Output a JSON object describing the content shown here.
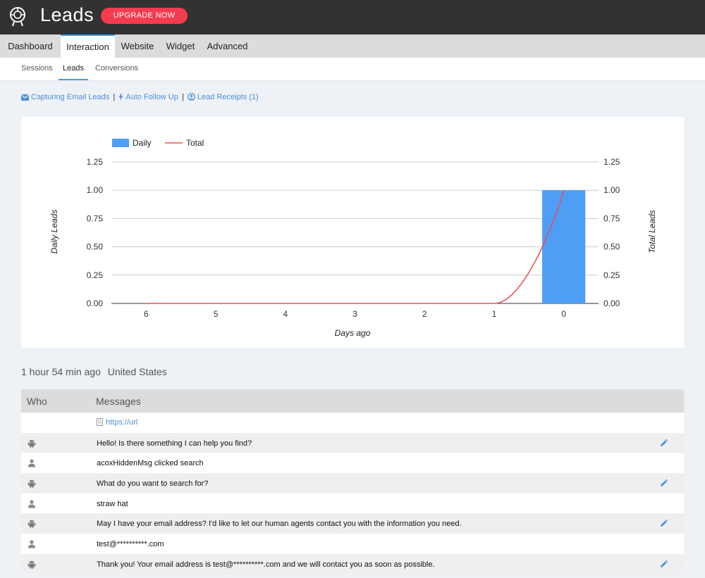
{
  "header": {
    "title": "Leads",
    "upgrade_label": "UPGRADE NOW"
  },
  "main_tabs": [
    {
      "label": "Dashboard"
    },
    {
      "label": "Interaction"
    },
    {
      "label": "Website"
    },
    {
      "label": "Widget"
    },
    {
      "label": "Advanced"
    }
  ],
  "sub_tabs": [
    {
      "label": "Sessions"
    },
    {
      "label": "Leads"
    },
    {
      "label": "Conversions"
    }
  ],
  "links": {
    "capturing": "Capturing Email Leads",
    "follow_up": "Auto Follow Up",
    "receipts": "Lead Receipts (1)",
    "separator": "|"
  },
  "chart_data": {
    "type": "bar",
    "categories": [
      "6",
      "5",
      "4",
      "3",
      "2",
      "1",
      "0"
    ],
    "series": [
      {
        "name": "Daily",
        "type": "bar",
        "values": [
          0,
          0,
          0,
          0,
          0,
          0,
          1
        ],
        "color": "#4e9ef5"
      },
      {
        "name": "Total",
        "type": "line",
        "values": [
          0,
          0,
          0,
          0,
          0,
          0,
          1
        ],
        "color": "#e9525a"
      }
    ],
    "xlabel": "Days ago",
    "ylabel": "Daily Leads",
    "y2label": "Total Leads",
    "yticks": [
      "0.00",
      "0.25",
      "0.50",
      "0.75",
      "1.00",
      "1.25"
    ],
    "ylim": [
      0,
      1.25
    ],
    "legend_position": "top-left",
    "grid": true
  },
  "session": {
    "time_ago": "1 hour 54 min ago",
    "location": "United States"
  },
  "table": {
    "col_who": "Who",
    "col_messages": "Messages",
    "url_text": "https://url",
    "rows": [
      {
        "who": "bot",
        "text": "Hello! Is there something I can help you find?",
        "editable": true
      },
      {
        "who": "user",
        "text": "acoxHiddenMsg clicked search",
        "editable": false
      },
      {
        "who": "bot",
        "text": "What do you want to search for?",
        "editable": true
      },
      {
        "who": "user",
        "text": "straw hat",
        "editable": false
      },
      {
        "who": "bot",
        "text": "May I have your email address? I'd like to let our human agents contact you with the information you need.",
        "editable": true
      },
      {
        "who": "user",
        "text": "test@**********.com",
        "editable": false
      },
      {
        "who": "bot",
        "text": "Thank you! Your email address is test@**********.com and we will contact you as soon as possible.",
        "editable": true
      }
    ]
  }
}
